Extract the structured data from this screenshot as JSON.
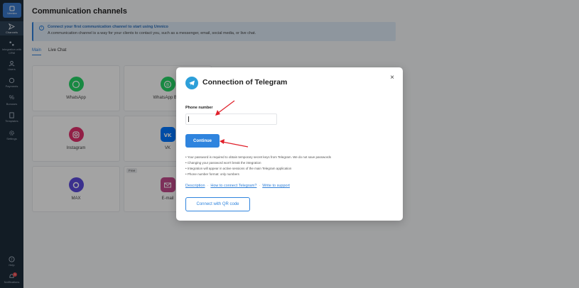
{
  "sidebar": {
    "logo_label": "Umnico",
    "items": [
      {
        "label": "Channels",
        "icon": "send-icon"
      },
      {
        "label": "Integration with CRM",
        "icon": "integration-icon"
      },
      {
        "label": "Users",
        "icon": "users-icon"
      },
      {
        "label": "Payments",
        "icon": "payments-icon"
      },
      {
        "label": "Bonuses",
        "icon": "percent-icon"
      },
      {
        "label": "Templates",
        "icon": "templates-icon"
      },
      {
        "label": "Settings",
        "icon": "gear-icon"
      }
    ],
    "bottom": [
      {
        "label": "Help",
        "icon": "help-icon"
      },
      {
        "label": "Notifications",
        "icon": "bell-icon",
        "badge": "1"
      }
    ]
  },
  "main": {
    "title": "Communication channels",
    "banner": {
      "title": "Connect your first communication channel to start using Umnico",
      "text": "A communication channel is a way for your clients to contact you, such as a messenger, email, social media, or live chat."
    },
    "tabs": [
      "Main",
      "Live Chat"
    ],
    "cards": [
      {
        "label": "WhatsApp",
        "icon": "whatsapp-icon",
        "color": "#25d366"
      },
      {
        "label": "WhatsApp Busi",
        "icon": "whatsapp-business-icon",
        "color": "#25d366"
      },
      {
        "label": "Instagram",
        "icon": "instagram-icon",
        "color": "#e1306c"
      },
      {
        "label": "VK",
        "icon": "vk-icon",
        "color": "#0077ff"
      },
      {
        "label": "MAX",
        "icon": "max-icon",
        "color": "#5b4bdb"
      },
      {
        "label": "E-mail",
        "icon": "email-icon",
        "color": "#c04a8a"
      }
    ],
    "free_tag": "Free"
  },
  "modal": {
    "title": "Connection of Telegram",
    "field_label": "Phone number",
    "phone_value": "",
    "continue_label": "Continue",
    "notes": [
      "Your password is required to obtain temporary secret keys from Telegram. We do not save passwords",
      "Changing your password won't break the integration",
      "Integration will appear in active sessions of the main Telegram application",
      "Phone number format: only numbers"
    ],
    "links": [
      "Description",
      "How to connect Telegram?",
      "Write to support"
    ],
    "link_separator": "·",
    "qr_label": "Connect with QR code",
    "close_symbol": "×"
  },
  "colors": {
    "accent": "#2f84de",
    "sidebar": "#1c2b3a",
    "arrow": "#e0202a"
  }
}
